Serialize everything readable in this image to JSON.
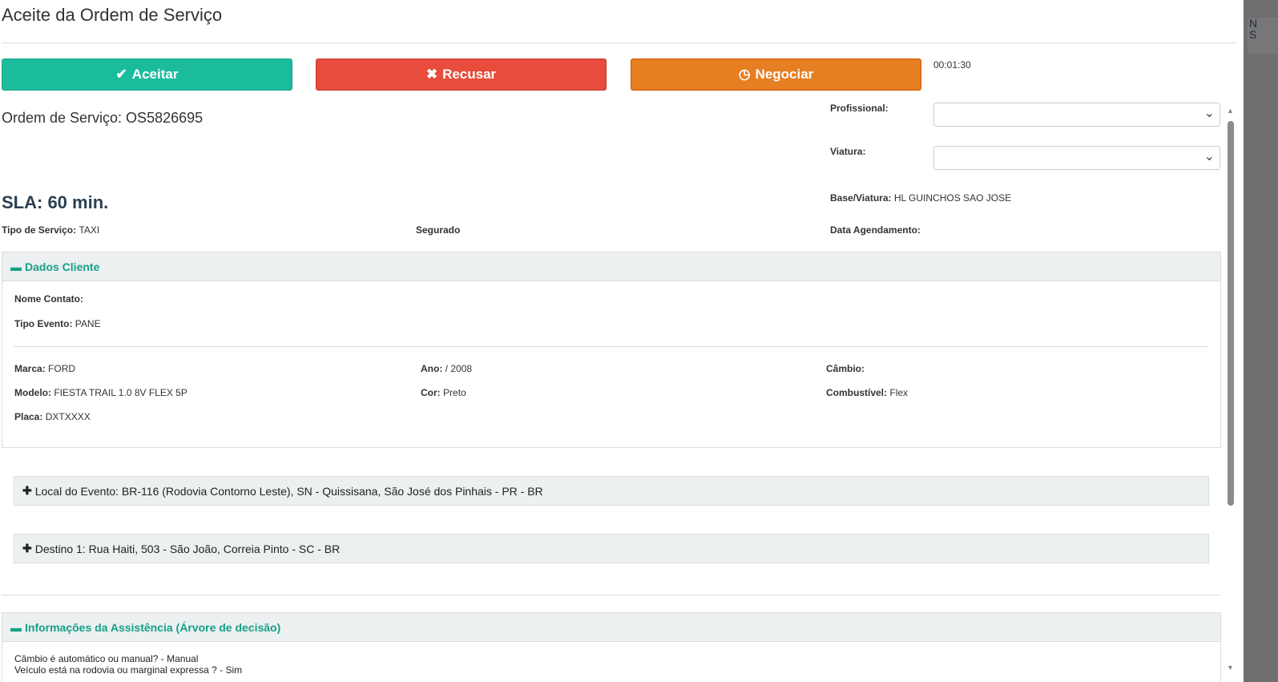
{
  "title": "Aceite da Ordem de Serviço",
  "actions": {
    "accept": "Aceitar",
    "refuse": "Recusar",
    "negotiate": "Negociar"
  },
  "timer": "00:01:30",
  "os_label": "Ordem de Serviço: OS5826695",
  "form": {
    "profissional_label": "Profissional:",
    "profissional_value": "",
    "viatura_label": "Viatura:",
    "viatura_value": ""
  },
  "base_label": "Base/Viatura:",
  "base_value": "HL GUINCHOS SAO JOSE",
  "sla": "SLA: 60 min.",
  "tipo_servico_label": "Tipo de Serviço:",
  "tipo_servico_value": "TAXI",
  "segurado_label": "Segurado",
  "data_agendamento_label": "Data Agendamento:",
  "cliente": {
    "title": "Dados Cliente",
    "nome_label": "Nome Contato:",
    "evento_label": "Tipo Evento:",
    "evento_value": "PANE",
    "marca_label": "Marca:",
    "marca": "FORD",
    "ano_label": "Ano:",
    "ano": "/ 2008",
    "cambio_label": "Câmbio:",
    "modelo_label": "Modelo:",
    "modelo": "FIESTA TRAIL 1.0 8V FLEX 5P",
    "cor_label": "Cor:",
    "cor": "Preto",
    "comb_label": "Combustível:",
    "comb": "Flex",
    "placa_label": "Placa:",
    "placa": "DXTXXXX"
  },
  "local": "Local do Evento: BR-116 (Rodovia Contorno Leste), SN - Quissisana, São José dos Pinhais - PR - BR",
  "destino": "Destino 1: Rua Haiti, 503 - São João, Correia Pinto - SC - BR",
  "assist": {
    "title": "Informações da Assistência (Árvore de decisão)",
    "lines": [
      "Câmbio é automático ou manual? - Manual",
      "Veículo está na rodovia ou marginal expressa ? - Sim"
    ]
  },
  "backdrop": {
    "l1": "N",
    "l2": "S"
  },
  "colors": {
    "accept": "#1abc9c",
    "refuse": "#e74c3c",
    "negotiate": "#e67e22",
    "panel_title": "#16a085"
  }
}
